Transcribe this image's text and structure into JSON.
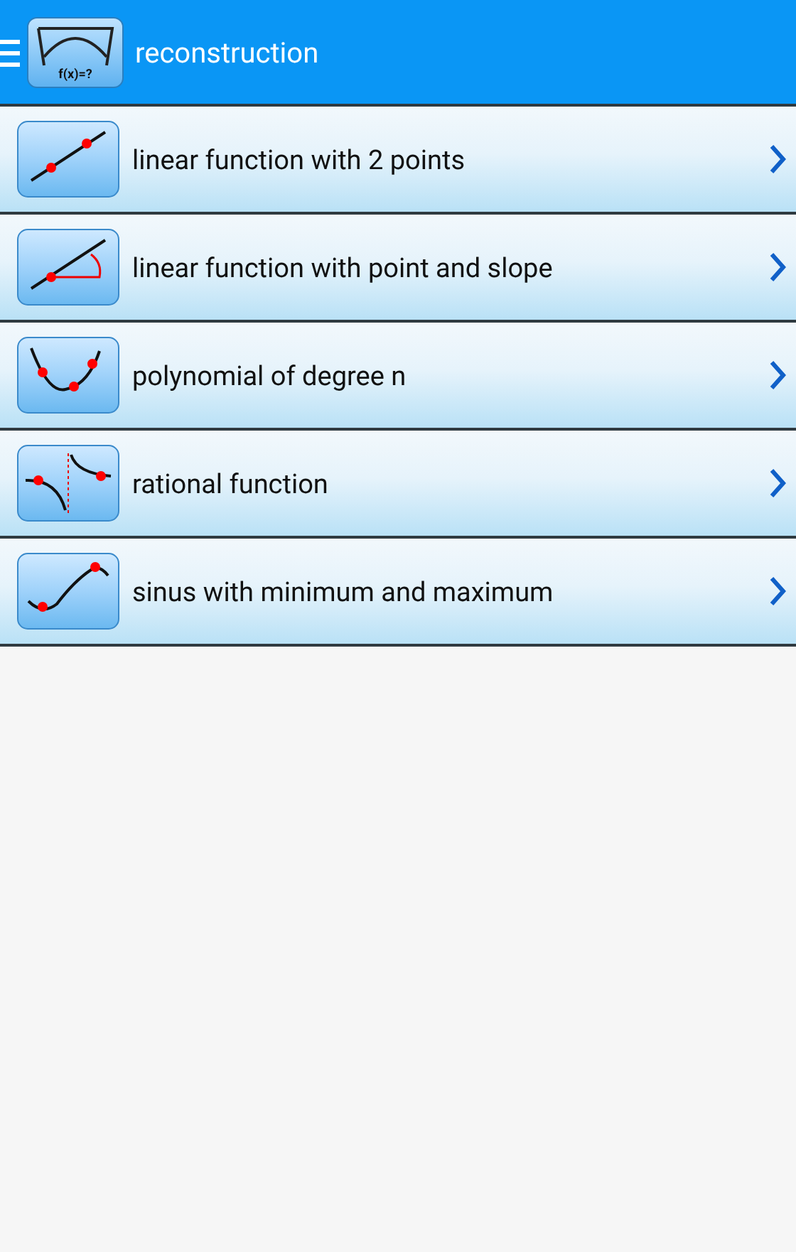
{
  "app_bar": {
    "logo_text": "f(x)=?",
    "title": "reconstruction"
  },
  "items": [
    {
      "kind": "two-points",
      "label": "linear function with 2 points"
    },
    {
      "kind": "point-slope",
      "label": "linear function with point and slope"
    },
    {
      "kind": "polynomial",
      "label": "polynomial of degree n"
    },
    {
      "kind": "rational",
      "label": "rational function"
    },
    {
      "kind": "sinus",
      "label": "sinus with minimum and maximum"
    }
  ]
}
